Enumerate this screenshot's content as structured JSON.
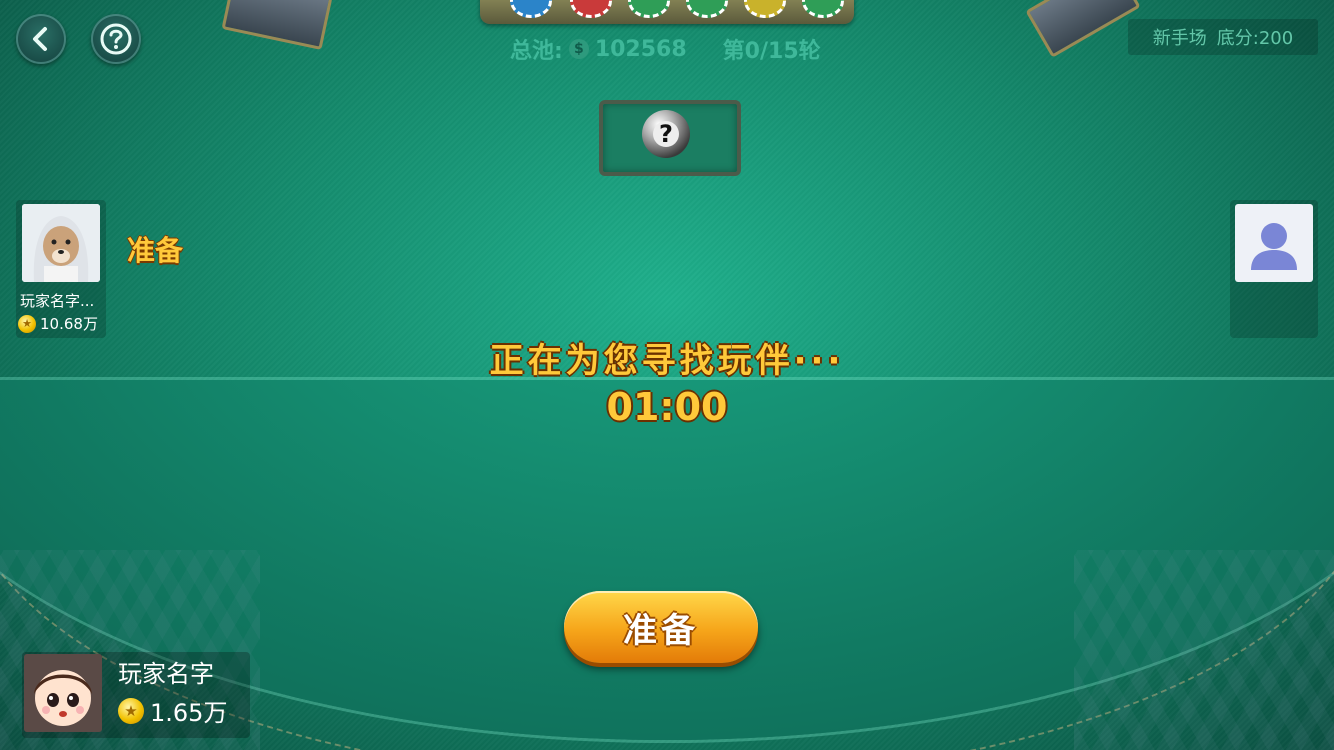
{
  "header": {
    "back_icon": "chevron-left-icon",
    "help_icon": "question-icon",
    "pot_label": "总池:",
    "pot_coin_symbol": "$",
    "pot_value": "102568",
    "round_info": "第0/15轮",
    "room_name": "新手场",
    "base_score": "底分:200"
  },
  "table": {
    "card_slot_symbol": "?",
    "waiting_message": "正在为您寻找玩伴···",
    "countdown": "01:00",
    "ready_button_label": "准备"
  },
  "players": {
    "left": {
      "name": "玩家名字...",
      "coins": "10.68万",
      "status": "准备"
    },
    "right": {
      "avatar_icon": "user-silhouette-icon"
    },
    "self": {
      "name": "玩家名字",
      "coins": "1.65万"
    }
  },
  "colors": {
    "felt": "#148a6c",
    "gold_text": "#ffc93a",
    "info_text": "#3fb89a"
  }
}
